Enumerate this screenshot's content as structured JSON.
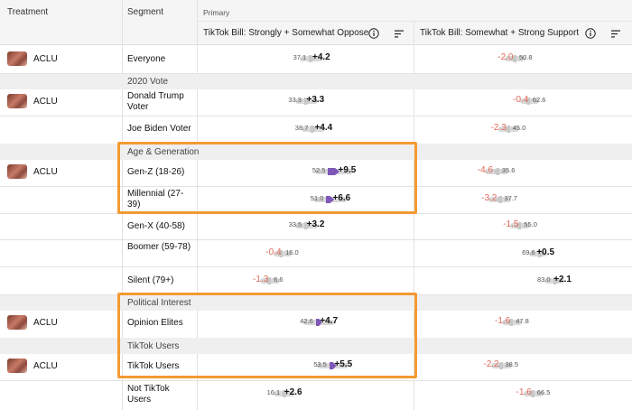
{
  "header": {
    "treatment_label": "Treatment",
    "segment_label": "Segment",
    "primary_label": "Primary",
    "metrics": [
      {
        "title": "TikTok Bill: Strongly + Somewhat Oppose",
        "info_icon": "info-circle-icon",
        "sort_icon": "sort-lines-icon"
      },
      {
        "title": "TikTok Bill: Somewhat + Strong Support",
        "info_icon": "info-circle-icon",
        "sort_icon": "sort-lines-icon"
      }
    ]
  },
  "colors": {
    "highlight": "#f29a33",
    "significant_bar": "#7e57b8",
    "neutral_bar": "#c8c8c8",
    "negative_text": "#e0695a"
  },
  "sections": [
    {
      "label": "2020 Vote"
    },
    {
      "label": "Age & Generation"
    },
    {
      "label": "Political Interest"
    },
    {
      "label": "TikTok Users"
    }
  ],
  "rows": [
    {
      "treatment": "ACLU",
      "segment": "Everyone",
      "oppose": {
        "base": "37.1",
        "delta": "+4.2"
      },
      "support": {
        "base": "50.8",
        "delta": "-2.0"
      }
    },
    {
      "treatment": "ACLU",
      "segment": "Donald Trump Voter",
      "oppose": {
        "base": "33.3",
        "delta": "+3.3"
      },
      "support": {
        "base": "62.6",
        "delta": "-0.4"
      }
    },
    {
      "treatment": "",
      "segment": "Joe Biden Voter",
      "oppose": {
        "base": "38.7",
        "delta": "+4.4"
      },
      "support": {
        "base": "45.0",
        "delta": "-2.3"
      }
    },
    {
      "treatment": "ACLU",
      "segment": "Gen-Z (18-26)",
      "oppose": {
        "base": "52.5",
        "delta": "+9.5"
      },
      "support": {
        "base": "35.6",
        "delta": "-4.6"
      }
    },
    {
      "treatment": "",
      "segment": "Millennial (27-39)",
      "oppose": {
        "base": "51.0",
        "delta": "+6.6"
      },
      "support": {
        "base": "37.7",
        "delta": "-3.2"
      }
    },
    {
      "treatment": "",
      "segment": "Gen-X (40-58)",
      "oppose": {
        "base": "33.5",
        "delta": "+3.2"
      },
      "support": {
        "base": "55.0",
        "delta": "-1.5"
      }
    },
    {
      "treatment": "",
      "segment": "Boomer (59-78)",
      "oppose": {
        "base": "16.0",
        "delta": "-0.4"
      },
      "support": {
        "base": "69.6",
        "delta": "+0.5"
      }
    },
    {
      "treatment": "",
      "segment": "Silent (79+)",
      "oppose": {
        "base": "6.6",
        "delta": "-1.3"
      },
      "support": {
        "base": "83.0",
        "delta": "+2.1"
      }
    },
    {
      "treatment": "ACLU",
      "segment": "Opinion Elites",
      "oppose": {
        "base": "42.6",
        "delta": "+4.7"
      },
      "support": {
        "base": "47.8",
        "delta": "-1.6"
      }
    },
    {
      "treatment": "ACLU",
      "segment": "TikTok Users",
      "oppose": {
        "base": "53.5",
        "delta": "+5.5"
      },
      "support": {
        "base": "38.5",
        "delta": "-2.2"
      }
    },
    {
      "treatment": "",
      "segment": "Not TikTok Users",
      "oppose": {
        "base": "16.1",
        "delta": "+2.6"
      },
      "support": {
        "base": "66.5",
        "delta": "-1.6"
      }
    }
  ]
}
